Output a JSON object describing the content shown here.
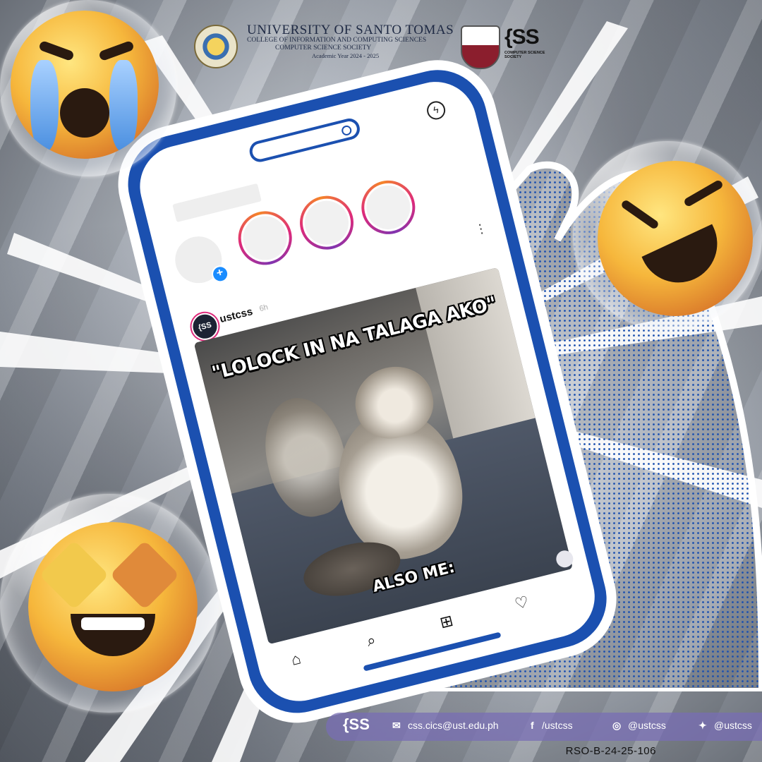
{
  "header": {
    "university": "UNIVERSITY OF SANTO TOMAS",
    "college": "COLLEGE OF INFORMATION AND COMPUTING SCIENCES",
    "society": "COMPUTER SCIENCE SOCIETY",
    "academic_year": "Academic Year 2024 - 2025",
    "css_logo": "{SS",
    "css_logo_sub": "COMPUTER SCIENCE SOCIETY"
  },
  "phone": {
    "post": {
      "username": "ustcss",
      "time": "6h",
      "avatar_text": "{SS"
    },
    "meme": {
      "top_text": "\"LOLOCK IN NA TALAGA AKO\"",
      "bottom_text": "ALSO ME:"
    },
    "nav": {
      "home_icon": "home-icon",
      "search_icon": "search-icon",
      "add_icon": "add-icon",
      "heart_icon": "heart-icon"
    }
  },
  "footer": {
    "logo": "{SS",
    "email": "css.cics@ust.edu.ph",
    "facebook": "/ustcss",
    "instagram": "@ustcss",
    "twitter": "@ustcss"
  },
  "rso_code": "RSO-B-24-25-106",
  "colors": {
    "accent_blue": "#1b50b0",
    "footer_purple": "#786eb4"
  }
}
